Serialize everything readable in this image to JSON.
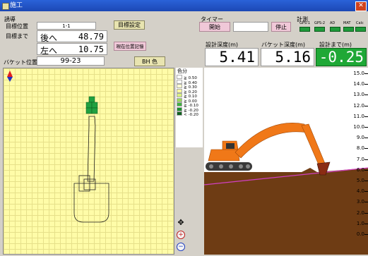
{
  "window": {
    "title": "施工"
  },
  "left_panel": {
    "group_label": "誘導",
    "target_pos_label": "目標位置",
    "target_pos_value": "1-1",
    "target_set_button": "目標設定",
    "target_dist_label": "目標まで",
    "dir1_label": "後へ",
    "dir1_value": "48.79",
    "dir2_label": "左へ",
    "dir2_value": "10.75",
    "current_pos_button": "現在位置記憶",
    "bucket_pos_label": "バケット位置",
    "bucket_pos_value": "99-23",
    "color_button": "BH 色"
  },
  "timer": {
    "label": "タイマー",
    "start_button": "開始",
    "stop_button": "停止"
  },
  "meters": {
    "label": "計測",
    "items": [
      {
        "name": "GPS-1"
      },
      {
        "name": "GPS-2"
      },
      {
        "name": "AD"
      },
      {
        "name": "MAT"
      },
      {
        "name": "Calc"
      }
    ]
  },
  "depths": {
    "design_label": "設計深度(m)",
    "design_value": "5.41",
    "bucket_label": "バケット深度(m)",
    "bucket_value": "5.16",
    "remaining_label": "設計まで(m)",
    "remaining_value": "-0.25"
  },
  "color_legend": {
    "label": "色分",
    "entries": [
      {
        "sym": "≧",
        "value": "0.50",
        "color": "#ffffff"
      },
      {
        "sym": "≧",
        "value": "0.40",
        "color": "#ffffff"
      },
      {
        "sym": "≧",
        "value": "0.30",
        "color": "#ffffd0"
      },
      {
        "sym": "≧",
        "value": "0.20",
        "color": "#fff8a0"
      },
      {
        "sym": "≧",
        "value": "0.10",
        "color": "#d8f080"
      },
      {
        "sym": "≧",
        "value": "0.00",
        "color": "#9ad860"
      },
      {
        "sym": "≧",
        "value": "-0.10",
        "color": "#40b040"
      },
      {
        "sym": "≧",
        "value": "-0.20",
        "color": "#209030"
      },
      {
        "sym": "<",
        "value": "-0.20",
        "color": "#106020"
      }
    ]
  },
  "ruler": {
    "ticks": [
      "15.0",
      "14.0",
      "13.0",
      "12.0",
      "11.0",
      "10.0",
      "9.0",
      "8.0",
      "7.0",
      "6.0",
      "5.0",
      "4.0",
      "3.0",
      "2.0",
      "1.0",
      "0.0"
    ]
  },
  "colors": {
    "remaining_bg": "#1fa836",
    "excavator_orange": "#f07818",
    "ground_brown": "#6e3c14",
    "design_line": "#d040c0",
    "grid_yellow": "#fffca8"
  }
}
